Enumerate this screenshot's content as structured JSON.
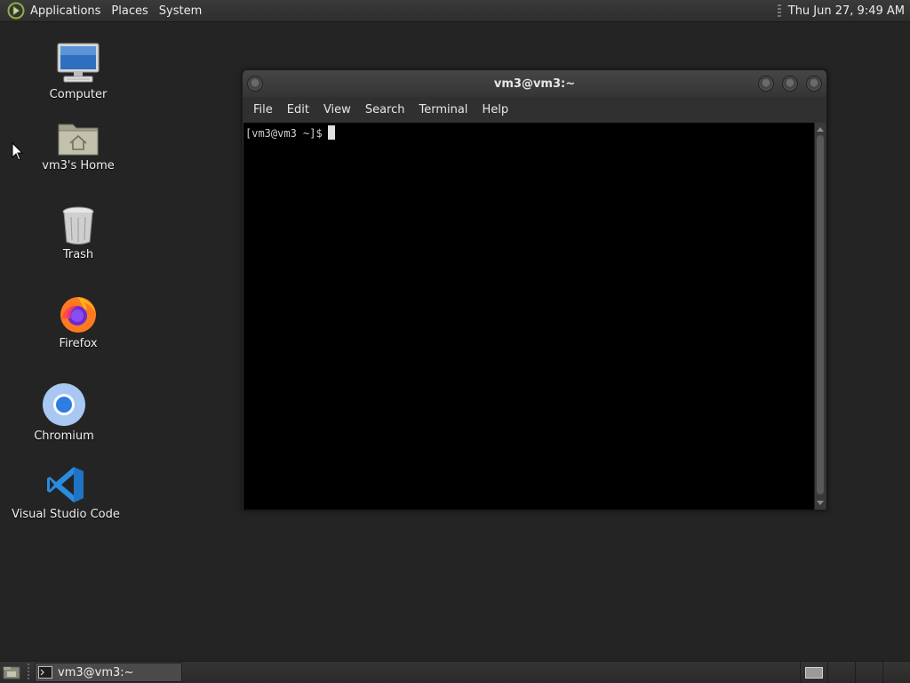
{
  "top_panel": {
    "menus": [
      "Applications",
      "Places",
      "System"
    ],
    "clock": "Thu Jun 27,  9:49 AM"
  },
  "desktop_icons": [
    {
      "label": "Computer",
      "icon": "computer-icon"
    },
    {
      "label": "vm3's Home",
      "icon": "home-folder-icon"
    },
    {
      "label": "Trash",
      "icon": "trash-icon"
    },
    {
      "label": "Firefox",
      "icon": "firefox-icon"
    },
    {
      "label": "Chromium",
      "icon": "chromium-icon"
    },
    {
      "label": "Visual Studio Code",
      "icon": "vscode-icon"
    }
  ],
  "terminal": {
    "title": "vm3@vm3:~",
    "menu": [
      "File",
      "Edit",
      "View",
      "Search",
      "Terminal",
      "Help"
    ],
    "prompt": "[vm3@vm3 ~]$"
  },
  "taskbar": {
    "window_label": "vm3@vm3:~",
    "workspace_count": 4,
    "active_workspace": 1
  },
  "colors": {
    "desktop_bg": "#242424",
    "terminal_bg": "#000000",
    "panel_bg": "#303030"
  }
}
